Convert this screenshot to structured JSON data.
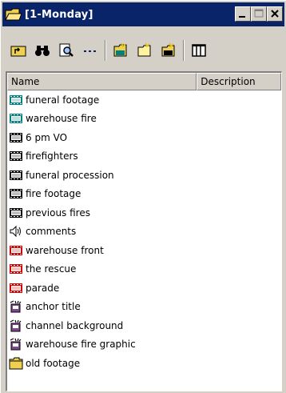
{
  "window": {
    "title": "[1-Monday]"
  },
  "columns": {
    "name": "Name",
    "description": "Description"
  },
  "items": [
    {
      "label": "funeral footage",
      "icon": "film-teal-icon"
    },
    {
      "label": "warehouse fire",
      "icon": "film-teal-icon"
    },
    {
      "label": "6 pm VO",
      "icon": "film-black-icon"
    },
    {
      "label": "firefighters",
      "icon": "film-black-icon"
    },
    {
      "label": "funeral procession",
      "icon": "film-black-icon"
    },
    {
      "label": "fire footage",
      "icon": "film-black-icon"
    },
    {
      "label": "previous fires",
      "icon": "film-black-icon"
    },
    {
      "label": "comments",
      "icon": "speaker-icon"
    },
    {
      "label": "warehouse front",
      "icon": "film-red-icon"
    },
    {
      "label": "the rescue",
      "icon": "film-red-icon"
    },
    {
      "label": "parade",
      "icon": "film-red-icon"
    },
    {
      "label": "anchor title",
      "icon": "title-tool-icon"
    },
    {
      "label": "channel background",
      "icon": "title-tool-icon"
    },
    {
      "label": "warehouse fire graphic",
      "icon": "title-tool-icon"
    },
    {
      "label": "old footage",
      "icon": "folder-icon"
    }
  ],
  "colors": {
    "titlebar": "#0a246a",
    "chrome": "#d4d0c8",
    "film_teal": "#008080",
    "film_red": "#d00000",
    "folder": "#f0d050"
  }
}
